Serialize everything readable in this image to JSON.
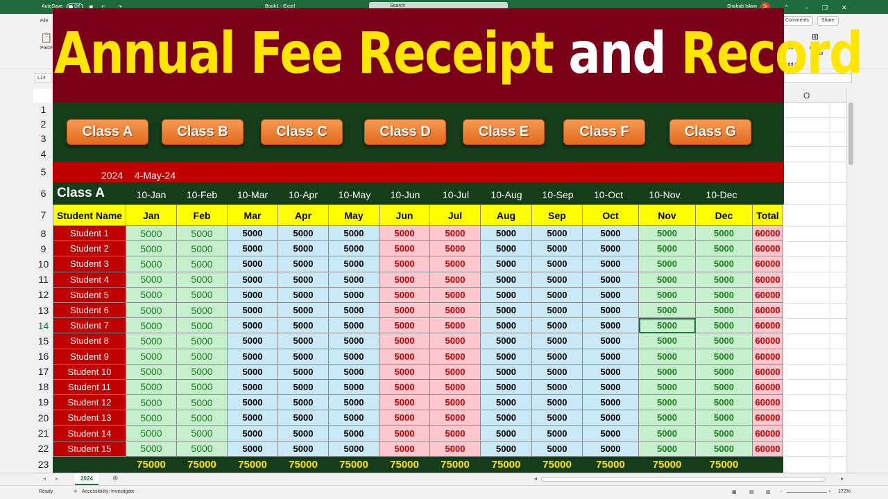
{
  "window": {
    "autosave_label": "AutoSave",
    "autosave_state": "Off",
    "file_title": "Book1 - Excel",
    "search_placeholder": "Search",
    "user_name": "Shahab Islam",
    "user_initials": "SI"
  },
  "ribbon": {
    "file_tab": "File",
    "paste_label": "Paste",
    "comments_label": "Comments",
    "share_label": "Share",
    "addins_label": "Add-ins",
    "analyze_label": "Analyze Data",
    "addins_group": "Add-ins"
  },
  "name_box": "L14",
  "column_O": "O",
  "title": {
    "part1": "Annual Fee Receipt ",
    "part2": "and ",
    "part3": "Record"
  },
  "class_buttons": [
    "Class A",
    "Class B",
    "Class C",
    "Class D",
    "Class E",
    "Class F",
    "Class G"
  ],
  "info": {
    "year": "2024",
    "date": "4-May-24"
  },
  "current_class": "Class A",
  "due_dates": [
    "10-Jan",
    "10-Feb",
    "10-Mar",
    "10-Apr",
    "10-May",
    "10-Jun",
    "10-Jul",
    "10-Aug",
    "10-Sep",
    "10-Oct",
    "10-Nov",
    "10-Dec"
  ],
  "table": {
    "headers": [
      "Student Name",
      "Jan",
      "Feb",
      "Mar",
      "Apr",
      "May",
      "Jun",
      "Jul",
      "Aug",
      "Sep",
      "Oct",
      "Nov",
      "Dec",
      "Total"
    ],
    "rows": [
      [
        "Student 1",
        "5000",
        "5000",
        "5000",
        "5000",
        "5000",
        "5000",
        "5000",
        "5000",
        "5000",
        "5000",
        "5000",
        "5000",
        "60000"
      ],
      [
        "Student 2",
        "5000",
        "5000",
        "5000",
        "5000",
        "5000",
        "5000",
        "5000",
        "5000",
        "5000",
        "5000",
        "5000",
        "5000",
        "60000"
      ],
      [
        "Student 3",
        "5000",
        "5000",
        "5000",
        "5000",
        "5000",
        "5000",
        "5000",
        "5000",
        "5000",
        "5000",
        "5000",
        "5000",
        "60000"
      ],
      [
        "Student 4",
        "5000",
        "5000",
        "5000",
        "5000",
        "5000",
        "5000",
        "5000",
        "5000",
        "5000",
        "5000",
        "5000",
        "5000",
        "60000"
      ],
      [
        "Student 5",
        "5000",
        "5000",
        "5000",
        "5000",
        "5000",
        "5000",
        "5000",
        "5000",
        "5000",
        "5000",
        "5000",
        "5000",
        "60000"
      ],
      [
        "Student 6",
        "5000",
        "5000",
        "5000",
        "5000",
        "5000",
        "5000",
        "5000",
        "5000",
        "5000",
        "5000",
        "5000",
        "5000",
        "60000"
      ],
      [
        "Student 7",
        "5000",
        "5000",
        "5000",
        "5000",
        "5000",
        "5000",
        "5000",
        "5000",
        "5000",
        "5000",
        "5000",
        "5000",
        "60000"
      ],
      [
        "Student 8",
        "5000",
        "5000",
        "5000",
        "5000",
        "5000",
        "5000",
        "5000",
        "5000",
        "5000",
        "5000",
        "5000",
        "5000",
        "60000"
      ],
      [
        "Student 9",
        "5000",
        "5000",
        "5000",
        "5000",
        "5000",
        "5000",
        "5000",
        "5000",
        "5000",
        "5000",
        "5000",
        "5000",
        "60000"
      ],
      [
        "Student 10",
        "5000",
        "5000",
        "5000",
        "5000",
        "5000",
        "5000",
        "5000",
        "5000",
        "5000",
        "5000",
        "5000",
        "5000",
        "60000"
      ],
      [
        "Student 11",
        "5000",
        "5000",
        "5000",
        "5000",
        "5000",
        "5000",
        "5000",
        "5000",
        "5000",
        "5000",
        "5000",
        "5000",
        "60000"
      ],
      [
        "Student 12",
        "5000",
        "5000",
        "5000",
        "5000",
        "5000",
        "5000",
        "5000",
        "5000",
        "5000",
        "5000",
        "5000",
        "5000",
        "60000"
      ],
      [
        "Student 13",
        "5000",
        "5000",
        "5000",
        "5000",
        "5000",
        "5000",
        "5000",
        "5000",
        "5000",
        "5000",
        "5000",
        "5000",
        "60000"
      ],
      [
        "Student 14",
        "5000",
        "5000",
        "5000",
        "5000",
        "5000",
        "5000",
        "5000",
        "5000",
        "5000",
        "5000",
        "5000",
        "5000",
        "60000"
      ],
      [
        "Student 15",
        "5000",
        "5000",
        "5000",
        "5000",
        "5000",
        "5000",
        "5000",
        "5000",
        "5000",
        "5000",
        "5000",
        "5000",
        "60000"
      ]
    ],
    "totals": [
      "",
      "75000",
      "75000",
      "75000",
      "75000",
      "75000",
      "75000",
      "75000",
      "75000",
      "75000",
      "75000",
      "75000",
      "75000",
      ""
    ]
  },
  "row_numbers": [
    "1",
    "2",
    "3",
    "4",
    "5",
    "6",
    "7",
    "8",
    "9",
    "10",
    "11",
    "12",
    "13",
    "14",
    "15",
    "16",
    "17",
    "18",
    "19",
    "20",
    "21",
    "22",
    "23"
  ],
  "sheet_tab": "2024",
  "status": {
    "ready": "Ready",
    "accessibility": "Accessibility: Investigate",
    "zoom": "172%"
  },
  "colors": {
    "title_bg": "#7a0017",
    "title_yellow": "#ffe600",
    "band_green": "#163d19",
    "button_orange": "#e56a1e",
    "header_red": "#c00000",
    "head_yellow": "#ffff00",
    "cell_green": "#c6efce",
    "cell_blue": "#c9e9f6",
    "cell_pink": "#ffc7ce"
  }
}
